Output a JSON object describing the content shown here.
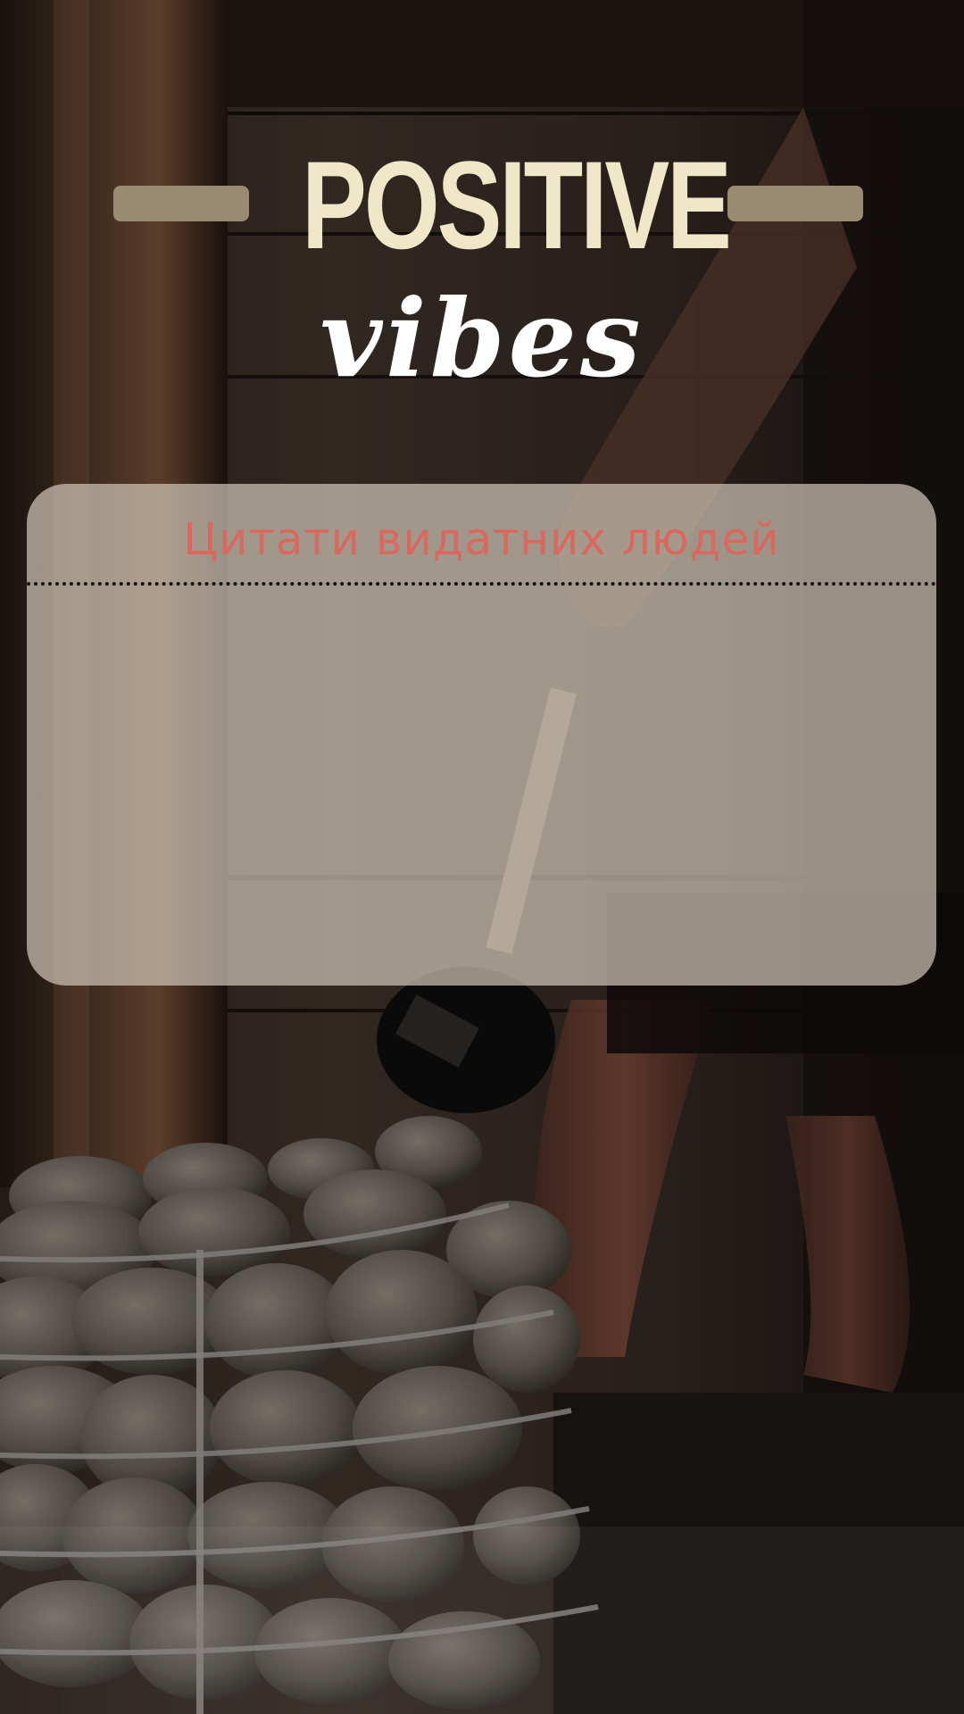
{
  "title": {
    "main": "POSITIVE",
    "script": "vibes"
  },
  "card": {
    "heading": "Цитати видатних людей",
    "body": ""
  },
  "colors": {
    "title_main": "#f0e6c8",
    "title_script": "#ffffff",
    "title_bars": "#9c8b73",
    "card_background": "rgba(205, 196, 180, 0.72)",
    "card_heading": "#d9685e",
    "divider": "#111111"
  },
  "background": {
    "description_icon": "sauna-stones-image"
  }
}
